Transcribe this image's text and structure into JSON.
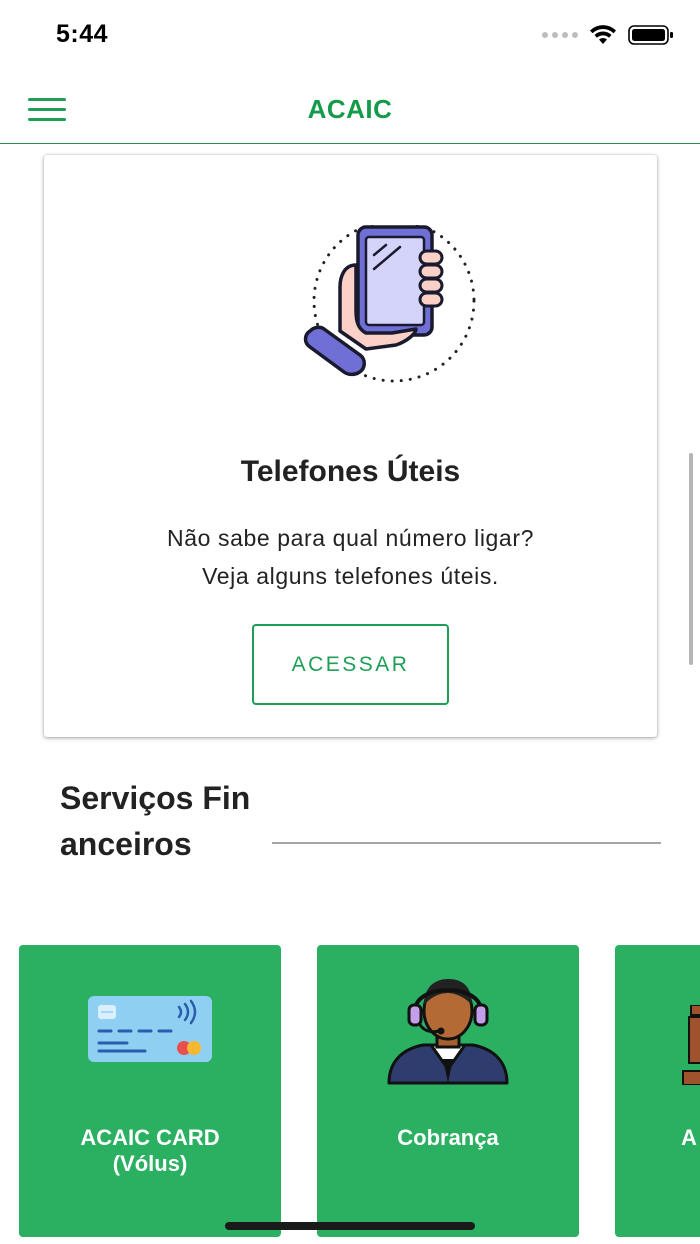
{
  "status_bar": {
    "time": "5:44"
  },
  "header": {
    "title": "ACAIC",
    "menu_icon": "hamburger-menu-icon"
  },
  "featured_card": {
    "icon": "hand-holding-phone-icon",
    "title": "Telefones Úteis",
    "description_line1": "Não sabe para qual número ligar?",
    "description_line2": "Veja alguns telefones úteis.",
    "button_label": "ACESSAR"
  },
  "financial_section": {
    "title": "Serviços Financeiros",
    "services": [
      {
        "label": "ACAIC CARD (Vólus)",
        "icon": "credit-card-icon"
      },
      {
        "label": "Cobrança",
        "icon": "support-agent-icon"
      },
      {
        "label": "A J",
        "icon": "gavel-icon"
      }
    ]
  },
  "colors": {
    "brand_green": "#149a4a",
    "card_green": "#2bb062",
    "accent_purple": "#6f6fd6"
  }
}
